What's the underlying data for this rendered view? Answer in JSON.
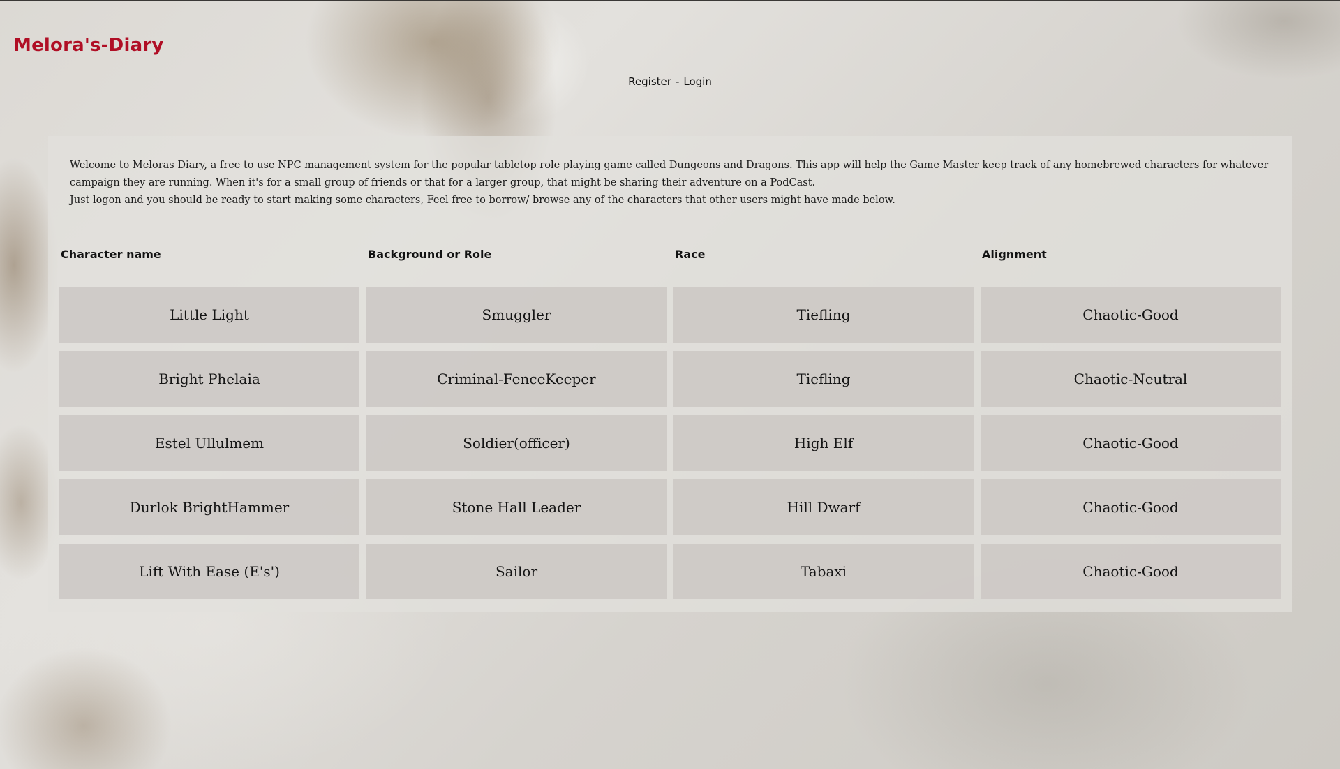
{
  "brand": {
    "title": "Melora's-Diary"
  },
  "auth": {
    "register_label": "Register",
    "separator": "-",
    "login_label": "Login"
  },
  "intro": {
    "paragraph_1": "Welcome to Meloras Diary, a free to use NPC management system for the popular tabletop role playing game called Dungeons and Dragons. This app will help the Game Master keep track of any homebrewed characters for whatever campaign they are running. When it's for a small group of friends or that for a larger group, that might be sharing their adventure on a PodCast.",
    "paragraph_2": "Just logon and you should be ready to start making some characters, Feel free to borrow/ browse any of the characters that other users might have made below."
  },
  "table": {
    "headers": [
      "Character name",
      "Background or Role",
      "Race",
      "Alignment"
    ],
    "rows": [
      [
        "Little Light",
        "Smuggler",
        "Tiefling",
        "Chaotic-Good"
      ],
      [
        "Bright Phelaia",
        "Criminal-FenceKeeper",
        "Tiefling",
        "Chaotic-Neutral"
      ],
      [
        "Estel Ullulmem",
        "Soldier(officer)",
        "High Elf",
        "Chaotic-Good"
      ],
      [
        "Durlok BrightHammer",
        "Stone Hall Leader",
        "Hill Dwarf",
        "Chaotic-Good"
      ],
      [
        "Lift With Ease (E's')",
        "Sailor",
        "Tabaxi",
        "Chaotic-Good"
      ]
    ]
  },
  "colors": {
    "brand": "#b00e25",
    "cell_background": "#cdc9c6",
    "text": "#151515"
  }
}
